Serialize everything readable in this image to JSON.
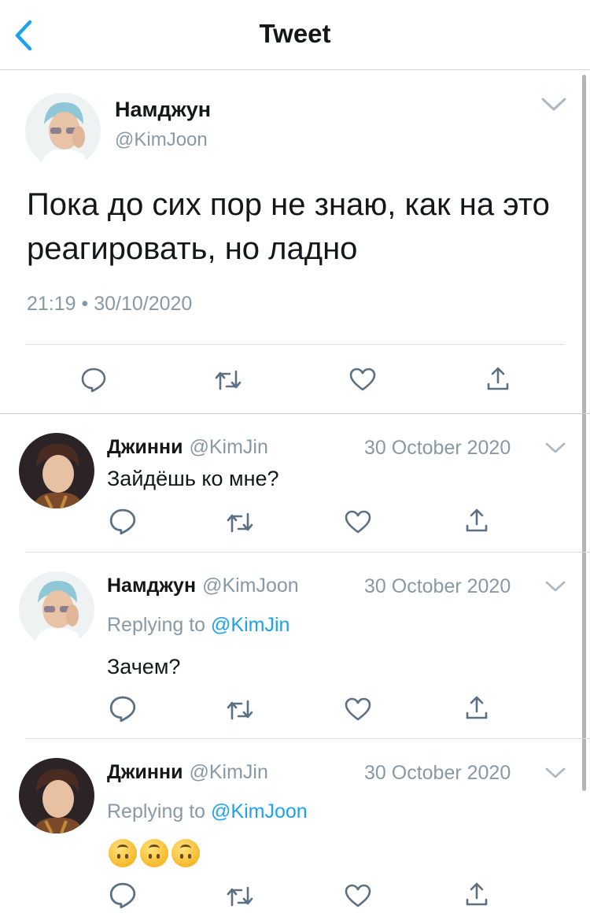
{
  "header": {
    "title": "Tweet"
  },
  "main_tweet": {
    "author_name": "Намджун",
    "handle": "@KimJoon",
    "text": "Пока до сих пор не знаю, как на это реагировать, но ладно",
    "timestamp": "21:19 • 30/10/2020"
  },
  "replies": [
    {
      "author_name": "Джинни",
      "handle": "@KimJin",
      "date": "30 October 2020",
      "replying_prefix": "",
      "replying_to": "",
      "text": "Зайдёшь ко мне?"
    },
    {
      "author_name": "Намджун",
      "handle": "@KimJoon",
      "date": "30 October 2020",
      "replying_prefix": "Replying to",
      "replying_to": "@KimJin",
      "text": "Зачем?"
    },
    {
      "author_name": "Джинни",
      "handle": "@KimJin",
      "date": "30 October 2020",
      "replying_prefix": "Replying to",
      "replying_to": "@KimJoon",
      "emoji_count": 3
    }
  ],
  "colors": {
    "accent": "#1da1f2",
    "secondary_text": "#8899a6",
    "icon": "#5b7083"
  },
  "icons": [
    "back-chevron-icon",
    "chevron-down-icon",
    "reply-icon",
    "retweet-icon",
    "like-icon",
    "share-icon",
    "upside-down-face-emoji"
  ]
}
